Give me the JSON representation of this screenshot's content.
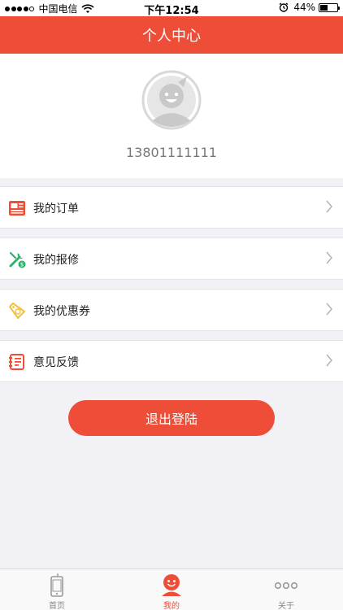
{
  "status_bar": {
    "carrier": "中国电信",
    "time": "下午12:54",
    "battery": "44%",
    "battery_level": 0.44,
    "signal_bars": 4
  },
  "nav": {
    "title": "个人中心"
  },
  "profile": {
    "phone": "13801111111"
  },
  "menu": [
    {
      "label": "我的订单",
      "icon": "order-icon"
    },
    {
      "label": "我的报修",
      "icon": "repair-icon"
    },
    {
      "label": "我的优惠券",
      "icon": "coupon-icon"
    },
    {
      "label": "意见反馈",
      "icon": "feedback-icon"
    }
  ],
  "logout_label": "退出登陆",
  "tabs": [
    {
      "label": "首页",
      "icon": "phone-icon"
    },
    {
      "label": "我的",
      "icon": "profile-icon",
      "active": true
    },
    {
      "label": "关于",
      "icon": "more-icon"
    }
  ],
  "colors": {
    "accent": "#ee4e37",
    "coupon": "#f3c23a",
    "repair": "#2db36b"
  }
}
